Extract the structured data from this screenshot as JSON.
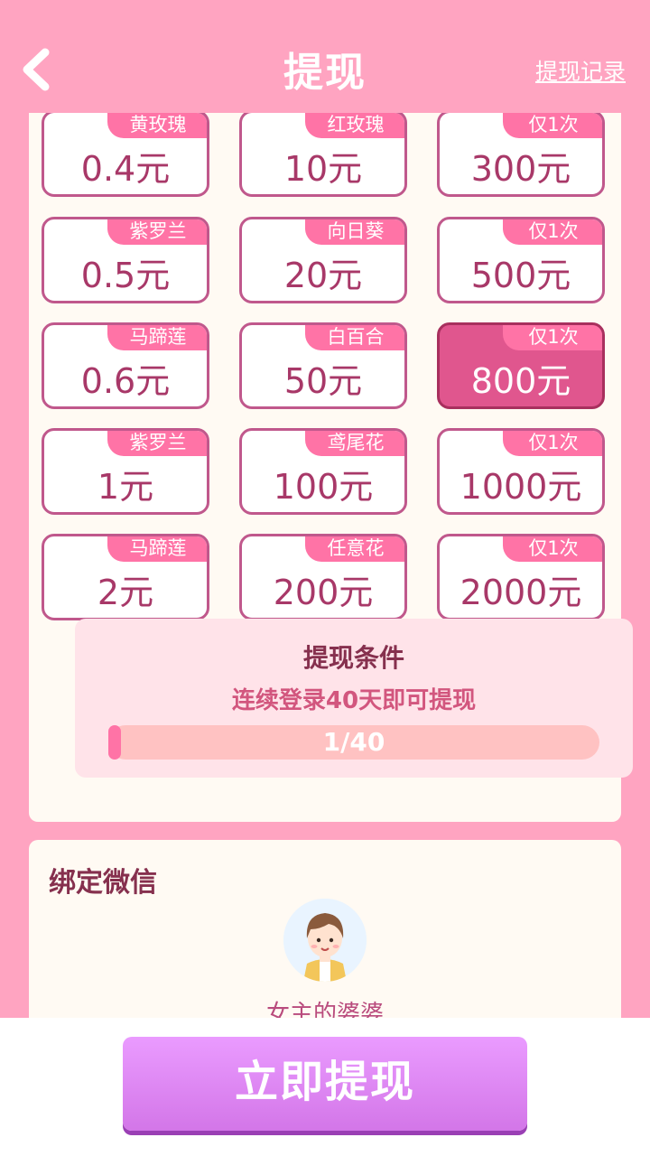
{
  "header": {
    "title": "提现",
    "records_link": "提现记录"
  },
  "tiles": [
    {
      "tag": "黄玫瑰",
      "amount": "0.4元"
    },
    {
      "tag": "红玫瑰",
      "amount": "10元"
    },
    {
      "tag": "仅1次",
      "amount": "300元"
    },
    {
      "tag": "紫罗兰",
      "amount": "0.5元"
    },
    {
      "tag": "向日葵",
      "amount": "20元"
    },
    {
      "tag": "仅1次",
      "amount": "500元"
    },
    {
      "tag": "马蹄莲",
      "amount": "0.6元"
    },
    {
      "tag": "白百合",
      "amount": "50元"
    },
    {
      "tag": "仅1次",
      "amount": "800元",
      "selected": true
    },
    {
      "tag": "紫罗兰",
      "amount": "1元"
    },
    {
      "tag": "鸢尾花",
      "amount": "100元"
    },
    {
      "tag": "仅1次",
      "amount": "1000元"
    },
    {
      "tag": "马蹄莲",
      "amount": "2元"
    },
    {
      "tag": "任意花",
      "amount": "200元"
    },
    {
      "tag": "仅1次",
      "amount": "2000元"
    }
  ],
  "condition": {
    "title": "提现条件",
    "description": "连续登录40天即可提现",
    "progress_text": "1/40",
    "progress_fraction": 0.025
  },
  "wechat": {
    "title": "绑定微信",
    "nickname": "女主的婆婆"
  },
  "withdraw_button": "立即提现",
  "colors": {
    "background": "#ffa4c1",
    "tag": "#ff73a6",
    "selected_tile": "#e0568e",
    "button": "#da80f0"
  }
}
